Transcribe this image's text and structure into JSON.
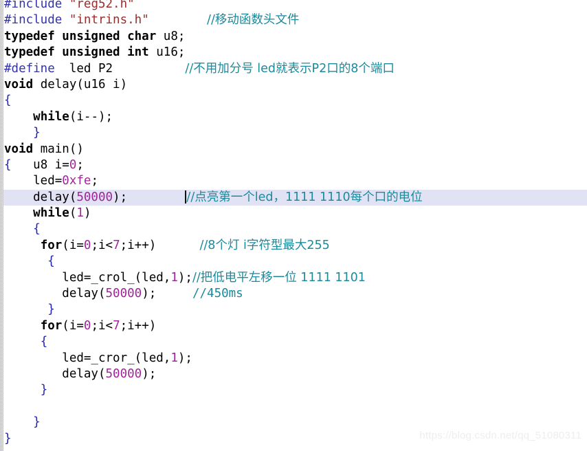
{
  "editor": {
    "language": "C",
    "colors": {
      "background": "#ffffff",
      "text": "#000000",
      "preprocessor": "#3333aa",
      "string": "#9c2c2c",
      "keyword": "#000000",
      "number": "#a0249c",
      "brace": "#2222bb",
      "comment": "#1a8a9c",
      "current_line_highlight": "#e2e2f5",
      "gutter": "#f2f2f2",
      "watermark": "#eeeeee"
    },
    "caret": {
      "visible": true,
      "line_index": 12
    }
  },
  "watermark": {
    "text": "https://blog.csdn.net/qq_51080311"
  },
  "code_lines": [
    {
      "index": 0,
      "highlighted": false,
      "tokens": [
        {
          "type": "pre",
          "text": "#include"
        },
        {
          "type": "plain",
          "text": " "
        },
        {
          "type": "str",
          "text": "\"reg52.h\""
        }
      ]
    },
    {
      "index": 1,
      "highlighted": false,
      "tokens": [
        {
          "type": "pre",
          "text": "#include"
        },
        {
          "type": "plain",
          "text": " "
        },
        {
          "type": "str",
          "text": "\"intrins.h\""
        },
        {
          "type": "plain",
          "text": "        "
        },
        {
          "type": "cmt",
          "text": "//移动函数头文件"
        }
      ]
    },
    {
      "index": 2,
      "highlighted": false,
      "tokens": [
        {
          "type": "kw",
          "text": "typedef unsigned char"
        },
        {
          "type": "plain",
          "text": " u8"
        },
        {
          "type": "punc",
          "text": ";"
        }
      ]
    },
    {
      "index": 3,
      "highlighted": false,
      "tokens": [
        {
          "type": "kw",
          "text": "typedef unsigned int"
        },
        {
          "type": "plain",
          "text": " u16"
        },
        {
          "type": "punc",
          "text": ";"
        }
      ]
    },
    {
      "index": 4,
      "highlighted": false,
      "tokens": [
        {
          "type": "pre",
          "text": "#define"
        },
        {
          "type": "plain",
          "text": "  led P2"
        },
        {
          "type": "plain",
          "text": "          "
        },
        {
          "type": "cmt",
          "text": "//不用加分号 led就表示P2口的8个端口"
        }
      ]
    },
    {
      "index": 5,
      "highlighted": false,
      "tokens": [
        {
          "type": "kw",
          "text": "void"
        },
        {
          "type": "plain",
          "text": " delay(u16 i)"
        }
      ]
    },
    {
      "index": 6,
      "highlighted": false,
      "tokens": [
        {
          "type": "brace",
          "text": "{"
        }
      ]
    },
    {
      "index": 7,
      "highlighted": false,
      "tokens": [
        {
          "type": "plain",
          "text": "    "
        },
        {
          "type": "kw",
          "text": "while"
        },
        {
          "type": "plain",
          "text": "(i--);"
        }
      ]
    },
    {
      "index": 8,
      "highlighted": false,
      "tokens": [
        {
          "type": "plain",
          "text": "    "
        },
        {
          "type": "brace",
          "text": "}"
        }
      ]
    },
    {
      "index": 9,
      "highlighted": false,
      "tokens": [
        {
          "type": "kw",
          "text": "void"
        },
        {
          "type": "plain",
          "text": " main()"
        }
      ]
    },
    {
      "index": 10,
      "highlighted": false,
      "tokens": [
        {
          "type": "brace",
          "text": "{"
        },
        {
          "type": "plain",
          "text": "   u8 i="
        },
        {
          "type": "num",
          "text": "0"
        },
        {
          "type": "punc",
          "text": ";"
        }
      ]
    },
    {
      "index": 11,
      "highlighted": false,
      "tokens": [
        {
          "type": "plain",
          "text": "    led="
        },
        {
          "type": "num",
          "text": "0xfe"
        },
        {
          "type": "punc",
          "text": ";"
        }
      ]
    },
    {
      "index": 12,
      "highlighted": true,
      "caret_before_comment": true,
      "tokens": [
        {
          "type": "plain",
          "text": "    delay("
        },
        {
          "type": "num",
          "text": "50000"
        },
        {
          "type": "plain",
          "text": ");"
        },
        {
          "type": "plain",
          "text": "        "
        },
        {
          "type": "caret",
          "text": ""
        },
        {
          "type": "cmt",
          "text": "//点亮第一个led，1111 1110每个口的电位"
        }
      ]
    },
    {
      "index": 13,
      "highlighted": false,
      "tokens": [
        {
          "type": "plain",
          "text": "    "
        },
        {
          "type": "kw",
          "text": "while"
        },
        {
          "type": "plain",
          "text": "("
        },
        {
          "type": "num",
          "text": "1"
        },
        {
          "type": "plain",
          "text": ")"
        }
      ]
    },
    {
      "index": 14,
      "highlighted": false,
      "tokens": [
        {
          "type": "plain",
          "text": "    "
        },
        {
          "type": "brace",
          "text": "{"
        }
      ]
    },
    {
      "index": 15,
      "highlighted": false,
      "tokens": [
        {
          "type": "plain",
          "text": "     "
        },
        {
          "type": "kw",
          "text": "for"
        },
        {
          "type": "plain",
          "text": "(i="
        },
        {
          "type": "num",
          "text": "0"
        },
        {
          "type": "plain",
          "text": ";i<"
        },
        {
          "type": "num",
          "text": "7"
        },
        {
          "type": "plain",
          "text": ";i++)"
        },
        {
          "type": "plain",
          "text": "      "
        },
        {
          "type": "cmt",
          "text": "//8个灯 i字符型最大255"
        }
      ]
    },
    {
      "index": 16,
      "highlighted": false,
      "tokens": [
        {
          "type": "plain",
          "text": "      "
        },
        {
          "type": "brace",
          "text": "{"
        }
      ]
    },
    {
      "index": 17,
      "highlighted": false,
      "tokens": [
        {
          "type": "plain",
          "text": "        led=_crol_(led,"
        },
        {
          "type": "num",
          "text": "1"
        },
        {
          "type": "plain",
          "text": ");"
        },
        {
          "type": "cmt",
          "text": "//把低电平左移一位 1111 1101"
        }
      ]
    },
    {
      "index": 18,
      "highlighted": false,
      "tokens": [
        {
          "type": "plain",
          "text": "        delay("
        },
        {
          "type": "num",
          "text": "50000"
        },
        {
          "type": "plain",
          "text": ");"
        },
        {
          "type": "plain",
          "text": "     "
        },
        {
          "type": "cmt",
          "text": "//450ms"
        }
      ]
    },
    {
      "index": 19,
      "highlighted": false,
      "tokens": [
        {
          "type": "plain",
          "text": "      "
        },
        {
          "type": "brace",
          "text": "}"
        }
      ]
    },
    {
      "index": 20,
      "highlighted": false,
      "tokens": [
        {
          "type": "plain",
          "text": "     "
        },
        {
          "type": "kw",
          "text": "for"
        },
        {
          "type": "plain",
          "text": "(i="
        },
        {
          "type": "num",
          "text": "0"
        },
        {
          "type": "plain",
          "text": ";i<"
        },
        {
          "type": "num",
          "text": "7"
        },
        {
          "type": "plain",
          "text": ";i++)"
        }
      ]
    },
    {
      "index": 21,
      "highlighted": false,
      "tokens": [
        {
          "type": "plain",
          "text": "     "
        },
        {
          "type": "brace",
          "text": "{"
        }
      ]
    },
    {
      "index": 22,
      "highlighted": false,
      "tokens": [
        {
          "type": "plain",
          "text": "        led=_cror_(led,"
        },
        {
          "type": "num",
          "text": "1"
        },
        {
          "type": "plain",
          "text": ");"
        }
      ]
    },
    {
      "index": 23,
      "highlighted": false,
      "tokens": [
        {
          "type": "plain",
          "text": "        delay("
        },
        {
          "type": "num",
          "text": "50000"
        },
        {
          "type": "plain",
          "text": ");"
        }
      ]
    },
    {
      "index": 24,
      "highlighted": false,
      "tokens": [
        {
          "type": "plain",
          "text": "     "
        },
        {
          "type": "brace",
          "text": "}"
        }
      ]
    },
    {
      "index": 25,
      "highlighted": false,
      "tokens": []
    },
    {
      "index": 26,
      "highlighted": false,
      "tokens": [
        {
          "type": "plain",
          "text": "    "
        },
        {
          "type": "brace",
          "text": "}"
        }
      ]
    },
    {
      "index": 27,
      "highlighted": false,
      "tokens": [
        {
          "type": "brace",
          "text": "}"
        }
      ]
    }
  ]
}
